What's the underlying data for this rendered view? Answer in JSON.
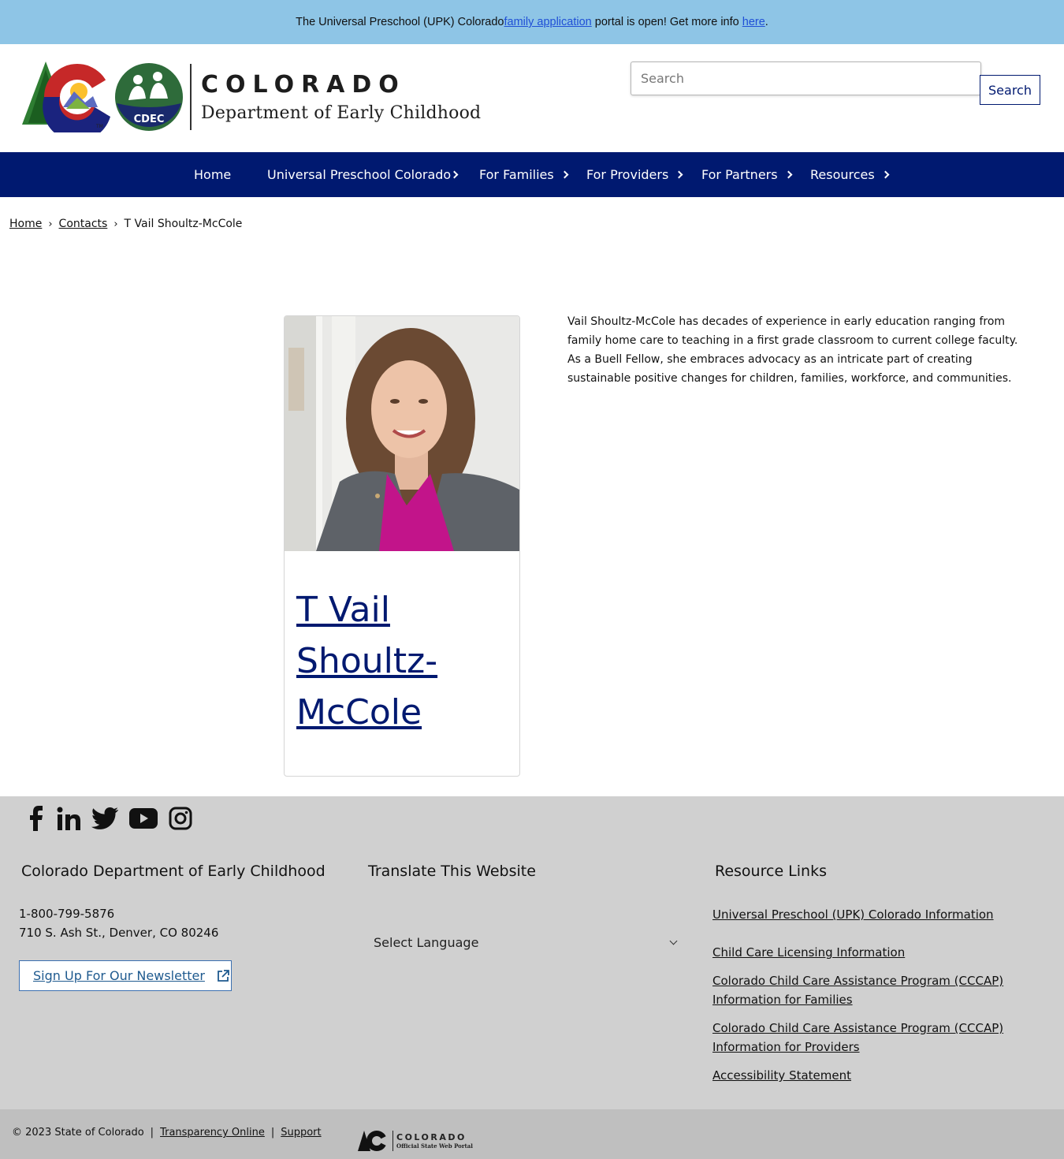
{
  "alert": {
    "prefix": "The Universal Preschool (UPK) Colorado ",
    "link1": "family application",
    "middle": " portal is open! Get more info ",
    "link2": "here",
    "suffix": "."
  },
  "header": {
    "logo_title": "COLORADO",
    "logo_subtitle": "Department of Early Childhood",
    "cdec_badge": "CDEC",
    "search_placeholder": "Search",
    "search_button": "Search"
  },
  "nav": {
    "items": [
      {
        "label": "Home"
      },
      {
        "label": "Universal Preschool Colorado"
      },
      {
        "label": "For Families"
      },
      {
        "label": "For Providers"
      },
      {
        "label": "For Partners"
      },
      {
        "label": "Resources"
      }
    ]
  },
  "breadcrumb": {
    "home": "Home",
    "contacts": "Contacts",
    "current": "T Vail Shoultz-McCole",
    "separator": "›"
  },
  "profile": {
    "name": "T Vail Shoultz-McCole",
    "bio": "Vail Shoultz-McCole has decades of experience in early education ranging from family home care to teaching in a first grade classroom to current college faculty. As a Buell Fellow, she embraces advocacy as an intricate part of creating sustainable positive changes for children, families, workforce, and communities."
  },
  "footer": {
    "social": [
      "facebook-icon",
      "linkedin-icon",
      "twitter-icon",
      "youtube-icon",
      "instagram-icon"
    ],
    "col1_title": "Colorado Department of Early Childhood",
    "phone": "1-800-799-5876",
    "address": "710 S. Ash St., Denver, CO 80246",
    "newsletter": "Sign Up For Our Newsletter",
    "col2_title": "Translate This Website",
    "language_select": "Select Language",
    "col3_title": "Resource Links",
    "links": [
      "Universal Preschool (UPK) Colorado Information",
      "Child Care Licensing Information",
      "Colorado Child Care Assistance Program (CCCAP) Information for Families",
      "Colorado Child Care Assistance Program (CCCAP) Information for Providers",
      "Accessibility Statement"
    ]
  },
  "bottom": {
    "copyright": "© 2023 State of Colorado",
    "pipe": "|",
    "transparency": "Transparency Online",
    "support": "Support",
    "state_logo_title": "COLORADO",
    "state_logo_sub": "Official State Web Portal"
  },
  "colors": {
    "nav_bg": "#001970",
    "alert_bg": "#8ec5e6",
    "footer_bg": "#d0d0d0",
    "link_blue": "#1f4fd6"
  }
}
